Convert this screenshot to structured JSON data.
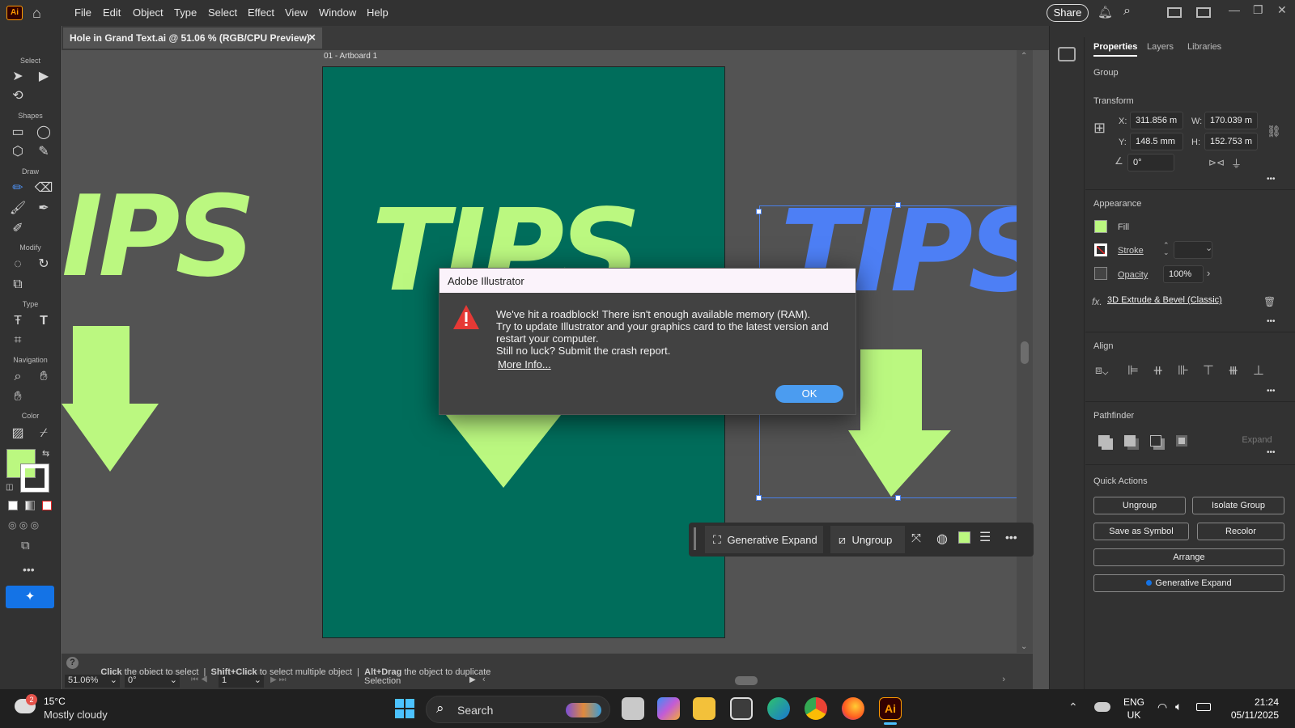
{
  "app": {
    "logo": "Ai",
    "menu": [
      "File",
      "Edit",
      "Object",
      "Type",
      "Select",
      "Effect",
      "View",
      "Window",
      "Help"
    ],
    "share": "Share"
  },
  "doc": {
    "tab": "Hole in Grand Text.ai @ 51.06 % (RGB/CPU Preview)",
    "close": "×",
    "artboard": "01 - Artboard 1"
  },
  "toolbar": {
    "select": "Select",
    "shapes": "Shapes",
    "draw": "Draw",
    "modify": "Modify",
    "type": "Type",
    "navigation": "Navigation",
    "color": "Color"
  },
  "canvas": {
    "word": "TIPS",
    "word_left": "IPS",
    "accent": "#bbf880",
    "bg": "#006d5b",
    "blue": "#4d7ff5"
  },
  "panel": {
    "tabs": [
      "Properties",
      "Layers",
      "Libraries"
    ],
    "group": "Group",
    "transform": {
      "title": "Transform",
      "x_label": "X:",
      "x": "311.856 m",
      "y_label": "Y:",
      "y": "148.5 mm",
      "w_label": "W:",
      "w": "170.039 m",
      "h_label": "H:",
      "h": "152.753 m",
      "angle": "0°"
    },
    "appearance": {
      "title": "Appearance",
      "fill": "Fill",
      "stroke": "Stroke",
      "opacity": "Opacity",
      "opacity_val": "100%",
      "effect": "3D Extrude & Bevel (Classic)",
      "fx": "fx."
    },
    "align": "Align",
    "pathfinder": "Pathfinder",
    "expand": "Expand",
    "quick": {
      "title": "Quick Actions",
      "ungroup": "Ungroup",
      "isolate": "Isolate Group",
      "symbol": "Save as Symbol",
      "recolor": "Recolor",
      "arrange": "Arrange",
      "genexp": "Generative Expand"
    }
  },
  "ctxbar": {
    "genexp": "Generative Expand",
    "ungroup": "Ungroup"
  },
  "dialog": {
    "title": "Adobe Illustrator",
    "line1": "We've hit a roadblock! There isn't enough available memory (RAM).",
    "line2": "Try to update Illustrator and your graphics card to the latest version and",
    "line3": "restart your computer.",
    "line4": "Still no luck? Submit the crash report.",
    "link": "More Info...",
    "ok": "OK"
  },
  "status": {
    "hint_a": "Click",
    "hint_b": " the object to select  |  ",
    "hint_c": "Shift+Click",
    "hint_d": " to select multiple object  |  ",
    "hint_e": "Alt+Drag",
    "hint_f": " the object to duplicate",
    "zoom": "51.06%",
    "rotate": "0°",
    "page": "1",
    "tool": "Selection"
  },
  "taskbar": {
    "temp": "15°C",
    "weather": "Mostly cloudy",
    "badge": "2",
    "search": "Search",
    "lang1": "ENG",
    "lang2": "UK",
    "time": "21:24",
    "date": "05/11/2025"
  }
}
